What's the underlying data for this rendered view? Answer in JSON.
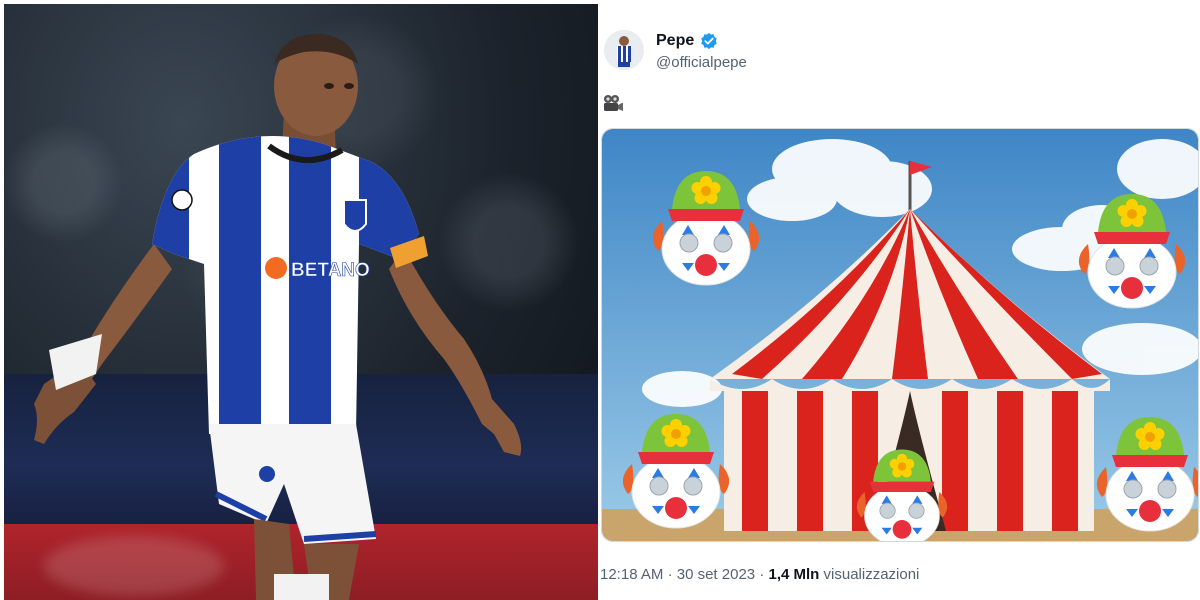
{
  "photo": {
    "shirt_sponsor": "BETANO",
    "colors": {
      "stripe_blue": "#1d3fa6",
      "stripe_white": "#ffffff",
      "sponsor_orange": "#f26b21"
    }
  },
  "tweet": {
    "display_name": "Pepe",
    "handle": "@officialpepe",
    "verified": true,
    "body_emoji": "🎥",
    "media": {
      "description_icons": [
        "circus-tent-icon",
        "clown-face-icon"
      ],
      "colors": {
        "sky": "#5aa3d8",
        "tent_red": "#d9231c",
        "tent_white": "#f6eee4",
        "ground": "#c9a46b"
      }
    },
    "time": "12:18 AM",
    "separator": "·",
    "date": "30 set 2023",
    "views_count": "1,4 Mln",
    "views_label": "visualizzazioni",
    "colors": {
      "verified_blue": "#1d9bf0",
      "text_primary": "#0f1419",
      "text_secondary": "#536471"
    }
  }
}
